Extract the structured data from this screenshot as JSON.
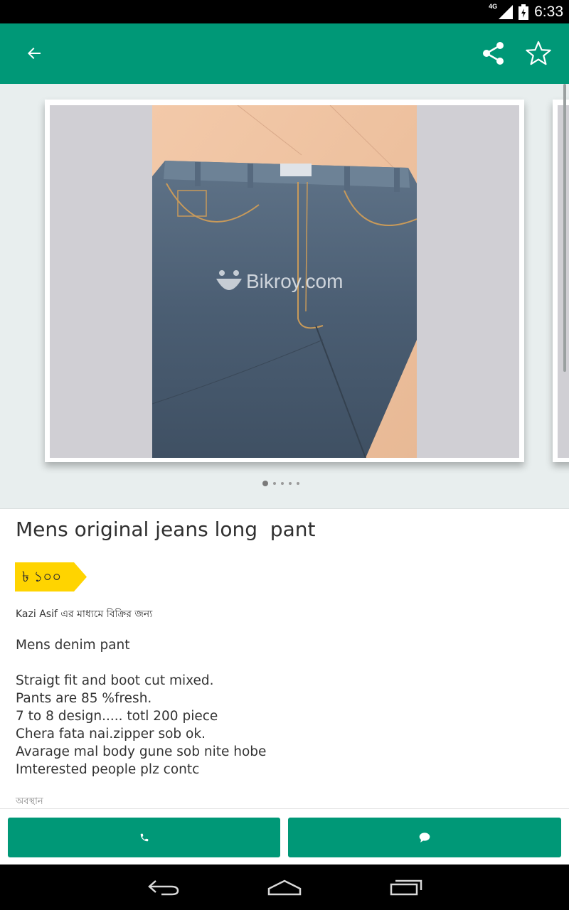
{
  "status_bar": {
    "network": "4G",
    "time": "6:33"
  },
  "app_bar": {
    "back_icon": "arrow-left-icon",
    "share_icon": "share-icon",
    "favorite_icon": "star-outline-icon"
  },
  "gallery": {
    "watermark": "Bikroy.com",
    "photo_count": 5,
    "current_photo": 1
  },
  "ad": {
    "title": "Mens original jeans long  pant",
    "price": "৳ ১০০",
    "seller_line": "Kazi Asif এর মাধ্যমে বিক্রির জন্য",
    "description_lines": [
      "Mens denim pant",
      "",
      "Straigt fit and boot cut mixed.",
      "Pants are 85 %fresh.",
      "7 to 8 design..... totl 200 piece",
      "Chera fata nai.zipper sob ok.",
      "Avarage mal body gune sob nite hobe",
      "Imterested people plz contc"
    ],
    "location_label": "অবস্থান"
  },
  "actions": {
    "call_icon": "phone-icon",
    "chat_icon": "chat-bubble-icon"
  },
  "colors": {
    "primary": "#009877",
    "price_tag": "#ffd400",
    "gallery_bg": "#e8eeee"
  }
}
